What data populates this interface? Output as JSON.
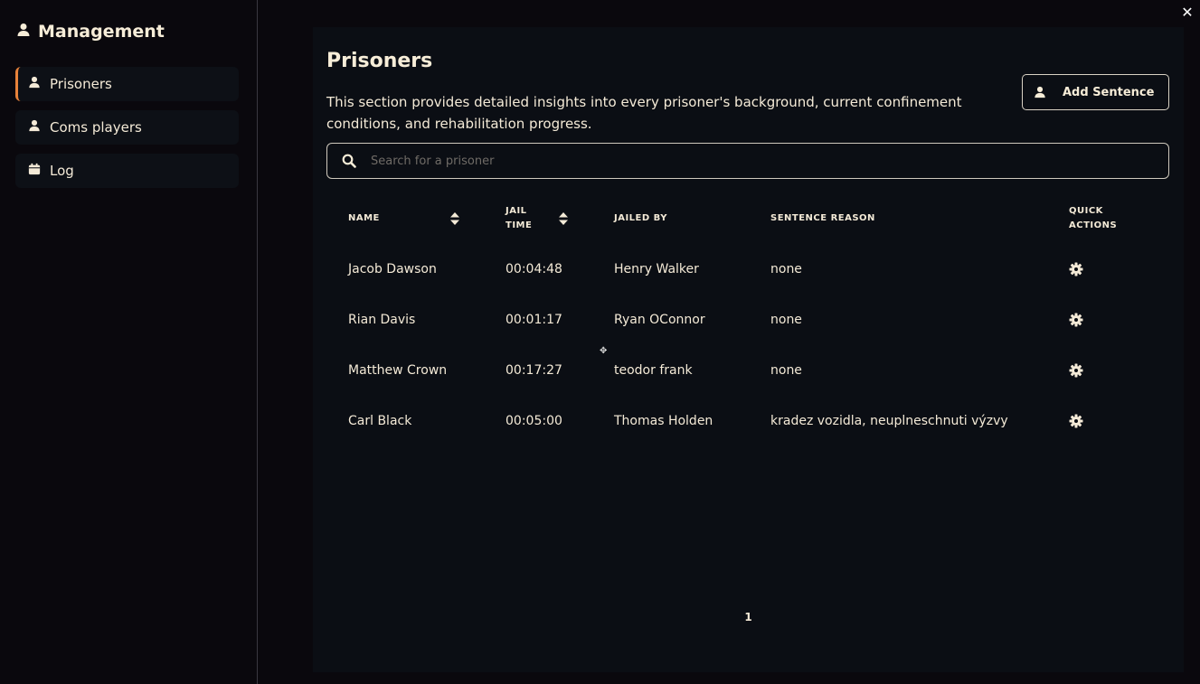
{
  "sidebar": {
    "title": "Management",
    "title_icon": "user-icon",
    "items": [
      {
        "label": "Prisoners",
        "icon": "user-icon",
        "active": true
      },
      {
        "label": "Coms players",
        "icon": "user-icon",
        "active": false
      },
      {
        "label": "Log",
        "icon": "calendar-icon",
        "active": false
      }
    ]
  },
  "window": {
    "close_label": "✕"
  },
  "main": {
    "title": "Prisoners",
    "description": "This section provides detailed insights into every prisoner's background, current confinement conditions, and rehabilitation progress.",
    "add_button_label": "Add Sentence",
    "search_placeholder": "Search for a prisoner",
    "table": {
      "headers": [
        "NAME",
        "JAIL TIME",
        "JAILED BY",
        "SENTENCE REASON",
        "QUICK ACTIONS"
      ],
      "rows": [
        {
          "name": "Jacob Dawson",
          "jail_time": "00:04:48",
          "jailed_by": "Henry Walker",
          "reason": "none"
        },
        {
          "name": "Rian Davis",
          "jail_time": "00:01:17",
          "jailed_by": "Ryan OConnor",
          "reason": "none"
        },
        {
          "name": "Matthew Crown",
          "jail_time": "00:17:27",
          "jailed_by": "teodor frank",
          "reason": "none"
        },
        {
          "name": "Carl Black",
          "jail_time": "00:05:00",
          "jailed_by": "Thomas Holden",
          "reason": "kradez vozidla, neuplneschnuti výzvy"
        }
      ]
    },
    "pagination": {
      "current_page": "1"
    }
  },
  "colors": {
    "background": "#0a080d",
    "panel": "#0b0e14",
    "accent": "#e8823a",
    "text": "#f4ead7"
  }
}
